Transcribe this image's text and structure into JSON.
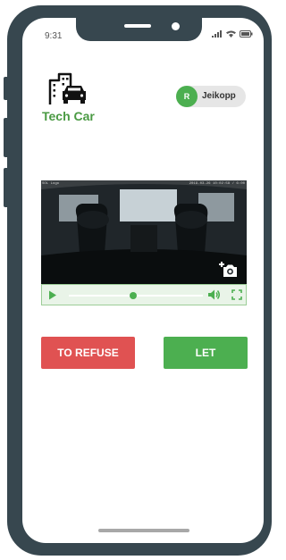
{
  "status_bar": {
    "time": "9:31",
    "icons": [
      "signal-icon",
      "wifi-icon",
      "battery-icon"
    ]
  },
  "brand": {
    "name": "Tech Car",
    "icon": "city-car-icon",
    "color": "#4a9a43"
  },
  "user": {
    "initial": "R",
    "name": "Jeikopp",
    "avatar_color": "#4caf50"
  },
  "video": {
    "overlay_left": "SOL Logo",
    "overlay_right": "2019-03-26 10:02:58 / 6:00",
    "progress": 0.48,
    "snapshot_icon": "add-photo-icon",
    "controls_color": "#4caf50"
  },
  "actions": {
    "refuse_label": "TO REFUSE",
    "refuse_color": "#e05252",
    "let_label": "LET",
    "let_color": "#4caf50"
  }
}
